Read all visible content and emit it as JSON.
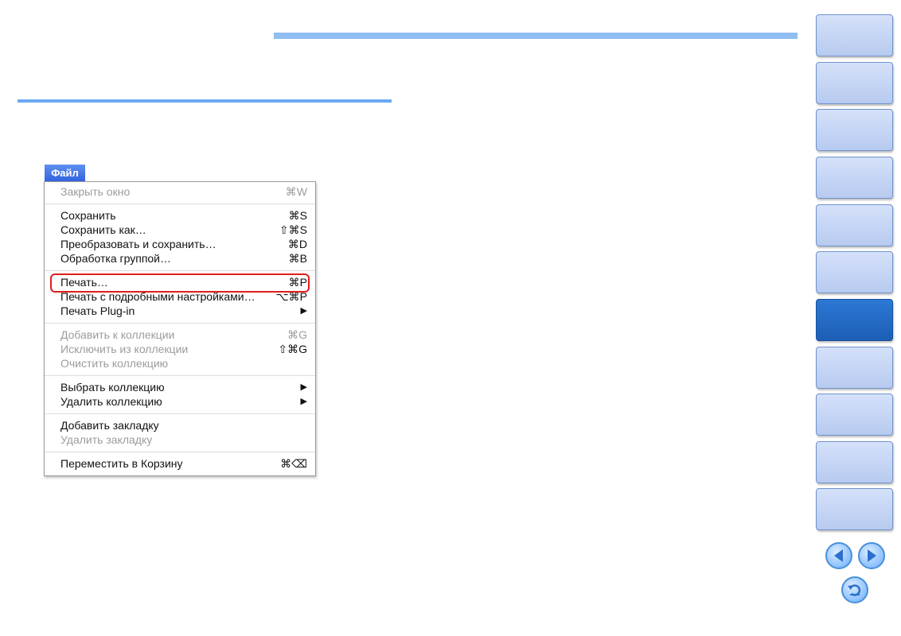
{
  "menu": {
    "title": "Файл",
    "items": [
      {
        "label": "Закрыть окно",
        "shortcut": "⌘W",
        "disabled": true
      },
      {
        "label": "Сохранить",
        "shortcut": "⌘S",
        "disabled": false
      },
      {
        "label": "Сохранить как…",
        "shortcut": "⇧⌘S",
        "disabled": false
      },
      {
        "label": "Преобразовать и сохранить…",
        "shortcut": "⌘D",
        "disabled": false
      },
      {
        "label": "Обработка группой…",
        "shortcut": "⌘B",
        "disabled": false
      },
      {
        "label": "Печать…",
        "shortcut": "⌘P",
        "disabled": false
      },
      {
        "label": "Печать с подробными настройками…",
        "shortcut": "⌥⌘P",
        "disabled": false
      },
      {
        "label": "Печать Plug-in",
        "submenu": "▶",
        "disabled": false
      },
      {
        "label": "Добавить к коллекции",
        "shortcut": "⌘G",
        "disabled": true
      },
      {
        "label": "Исключить из коллекции",
        "shortcut": "⇧⌘G",
        "disabled": true
      },
      {
        "label": "Очистить коллекцию",
        "disabled": true
      },
      {
        "label": "Выбрать коллекцию",
        "submenu": "▶",
        "disabled": false
      },
      {
        "label": "Удалить коллекцию",
        "submenu": "▶",
        "disabled": false
      },
      {
        "label": "Добавить закладку",
        "disabled": false
      },
      {
        "label": "Удалить закладку",
        "disabled": true
      },
      {
        "label": "Переместить в Корзину",
        "shortcut": "⌘⌫",
        "disabled": false
      }
    ]
  },
  "side_tabs": {
    "count": 11,
    "active_index": 6
  },
  "colors": {
    "accent_bar": "#8fbef2",
    "highlight": "#e01e1e",
    "tab_active": "#2b78d4",
    "tab_inactive": "#c8d7f5"
  },
  "nav": {
    "prev_icon": "prev-arrow-icon",
    "next_icon": "next-arrow-icon",
    "return_icon": "return-icon"
  }
}
